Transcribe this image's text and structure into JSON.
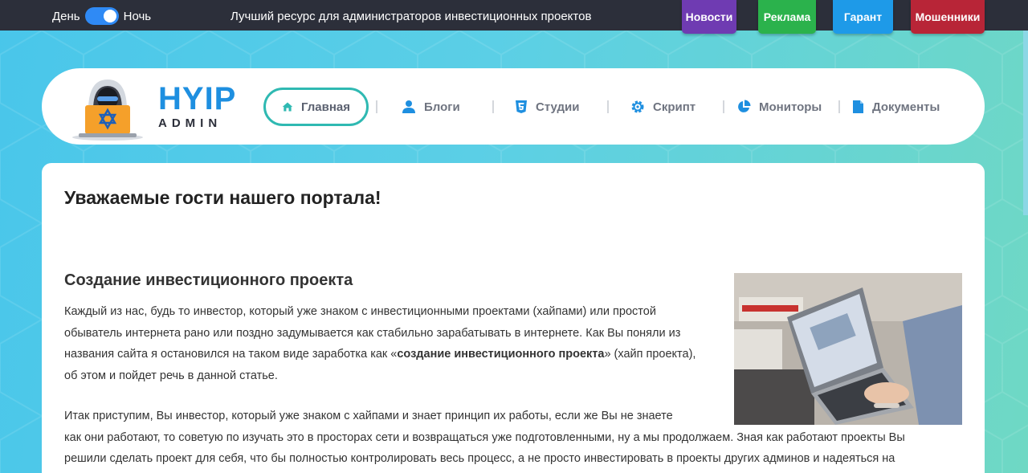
{
  "topbar": {
    "day_label": "День",
    "night_label": "Ночь",
    "tagline": "Лучший ресурс для администраторов инвестиционных проектов",
    "buttons": [
      {
        "label": "Новости",
        "color": "#6f3bb2"
      },
      {
        "label": "Реклама",
        "color": "#2bb24c"
      },
      {
        "label": "Гарант",
        "color": "#1e9ae8"
      },
      {
        "label": "Мошенники",
        "color": "#b82537"
      }
    ]
  },
  "brand": {
    "line1": "HYIP",
    "line2": "ADMIN",
    "primary_color": "#1e8fe0",
    "logo_icon": "hacker-laptop-icon"
  },
  "nav": {
    "items": [
      {
        "label": "Главная",
        "icon": "home-icon",
        "active": true
      },
      {
        "label": "Блоги",
        "icon": "user-icon"
      },
      {
        "label": "Студии",
        "icon": "html5-icon"
      },
      {
        "label": "Скрипт",
        "icon": "gear-icon"
      },
      {
        "label": "Мониторы",
        "icon": "pie-chart-icon"
      },
      {
        "label": "Документы",
        "icon": "document-icon"
      }
    ],
    "active_color": "#2fb9b2"
  },
  "content": {
    "heading": "Уважаемые гости нашего портала!",
    "subheading": "Создание инвестиционного проекта",
    "p1_before": "Каждый из нас, будь то инвестор, который уже знаком с инвестиционными проектами (хайпами) или простой обыватель интернета рано или поздно задумывается как стабильно зарабатывать в интернете. Как Вы поняли из названия сайта я остановился на таком виде заработка как «",
    "p1_bold": "создание инвестиционного проекта",
    "p1_after": "» (хайп проекта), об этом и пойдет речь в данной статье.",
    "p2_line1": "Итак приступим, Вы инвестор, который уже знаком с хайпами и знает принцип их работы, если же Вы не знаете",
    "p2_rest": "как они работают, то советую по изучать это в просторах сети и возвращаться уже подготовленными, ну а мы продолжаем. Зная как работают проекты Вы решили сделать проект для себя, что бы полностью контролировать весь процесс, а не просто инвестировать в проекты других админов и надеяться на"
  }
}
